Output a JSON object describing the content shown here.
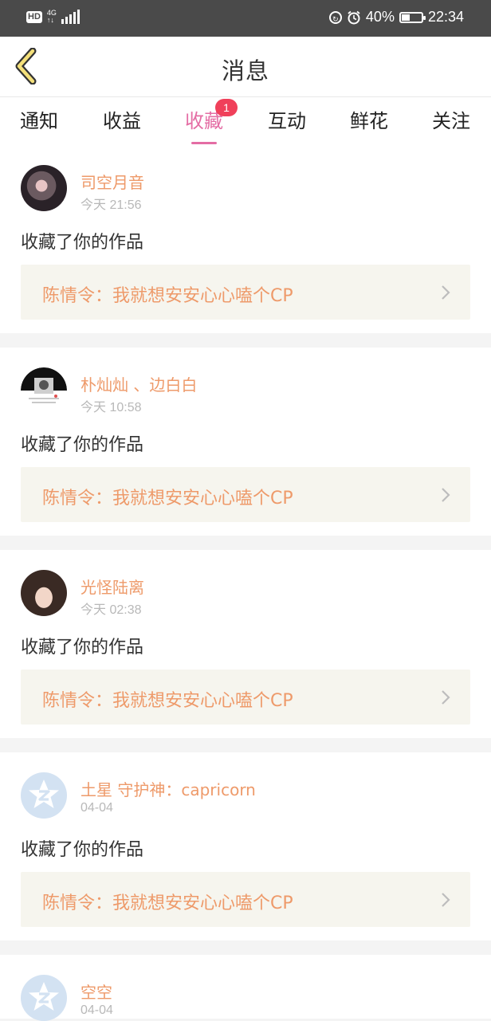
{
  "status_bar": {
    "hd": "HD",
    "network": "4G",
    "battery_percent": "40%",
    "time": "22:34",
    "battery_level": 0.4
  },
  "header": {
    "title": "消息",
    "back_icon": "chevron-left-icon"
  },
  "tabs": [
    {
      "label": "通知"
    },
    {
      "label": "收益"
    },
    {
      "label": "收藏",
      "active": true,
      "badge": "1"
    },
    {
      "label": "互动"
    },
    {
      "label": "鲜花"
    },
    {
      "label": "关注"
    }
  ],
  "feed": [
    {
      "user": "司空月音",
      "time": "今天 21:56",
      "action": "收藏了你的作品",
      "work": "陈情令：我就想安安心心嗑个CP"
    },
    {
      "user": "朴灿灿 、边白白",
      "time": "今天 10:58",
      "action": "收藏了你的作品",
      "work": "陈情令：我就想安安心心嗑个CP"
    },
    {
      "user": "光怪陆离",
      "time": "今天 02:38",
      "action": "收藏了你的作品",
      "work": "陈情令：我就想安安心心嗑个CP"
    },
    {
      "user": "土星 守护神：capricorn",
      "time": "04-04",
      "action": "收藏了你的作品",
      "work": "陈情令：我就想安安心心嗑个CP"
    },
    {
      "user": "空空",
      "time": "04-04"
    }
  ],
  "colors": {
    "accent": "#e46da4",
    "badge": "#f0405a",
    "name": "#ee9a6a",
    "box_bg": "#f6f5ee"
  }
}
